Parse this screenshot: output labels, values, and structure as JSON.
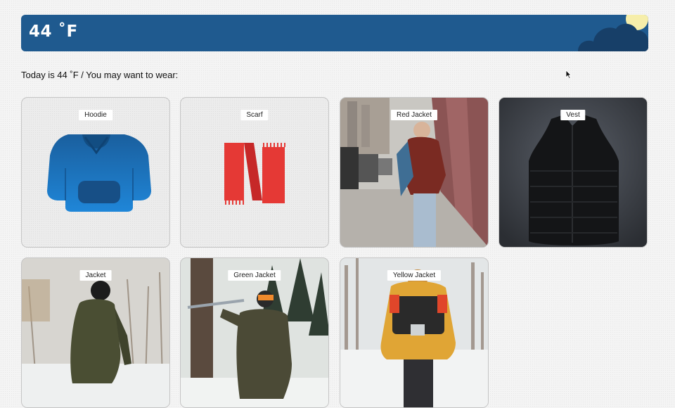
{
  "header": {
    "temperature": "44 ˚F"
  },
  "intro": "Today is 44 ˚F / You may want to wear:",
  "items": [
    {
      "label": "Hoodie"
    },
    {
      "label": "Scarf"
    },
    {
      "label": "Red Jacket"
    },
    {
      "label": "Vest"
    },
    {
      "label": "Jacket"
    },
    {
      "label": "Green Jacket"
    },
    {
      "label": "Yellow Jacket"
    }
  ],
  "colors": {
    "header_bg": "#1f5a8f",
    "hoodie_blue": "#1c74c4",
    "scarf_red": "#e53935",
    "sun": "#f6eeaa"
  },
  "icons": [
    "cloud-sun-icon",
    "cursor-icon",
    "hoodie-icon",
    "scarf-icon"
  ]
}
